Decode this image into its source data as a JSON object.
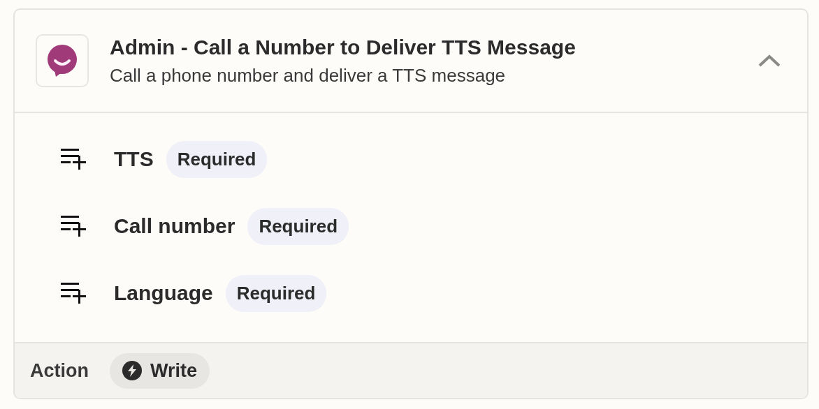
{
  "card": {
    "title": "Admin - Call a Number to Deliver TTS Message",
    "subtitle": "Call a phone number and deliver a TTS message",
    "expanded": true,
    "fields": [
      {
        "label": "TTS",
        "badge": "Required"
      },
      {
        "label": "Call number",
        "badge": "Required"
      },
      {
        "label": "Language",
        "badge": "Required"
      }
    ],
    "footer": {
      "label": "Action",
      "chip": "Write"
    }
  }
}
